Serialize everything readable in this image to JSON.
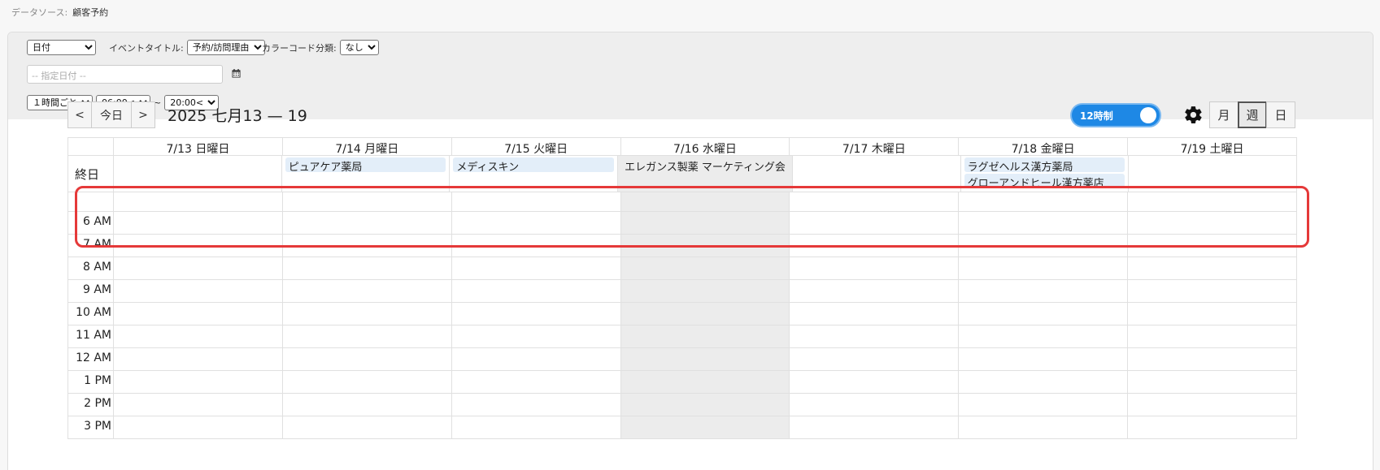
{
  "datasource": {
    "label": "データソース:",
    "value": "顧客予約"
  },
  "controls": {
    "date_field": "日付",
    "event_title_label": "イベントタイトル:",
    "event_title_value": "予約/訪問理由",
    "color_code_label": "カラーコード分類:",
    "color_code_value": "なし",
    "date_placeholder": "-- 指定日付 --",
    "interval": "１時間ごと",
    "start_time": "06:00<",
    "tilde": "~",
    "end_time": "20:00<"
  },
  "nav": {
    "prev": "<",
    "today": "今日",
    "next": ">"
  },
  "range_title": "2025 七月13 — 19",
  "toggle_label": "12時制",
  "views": {
    "month": "月",
    "week": "週",
    "day": "日"
  },
  "calendar": {
    "days": [
      "7/13 日曜日",
      "7/14 月曜日",
      "7/15 火曜日",
      "7/16 水曜日",
      "7/17 木曜日",
      "7/18 金曜日",
      "7/19 土曜日"
    ],
    "allday_label": "終日",
    "allday_events": {
      "d1": "ピュアケア薬局",
      "d2": "メディスキン",
      "d3": "エレガンス製薬 マーケティング会",
      "d5a": "ラグゼヘルス漢方薬局",
      "d5b": "グローアンドヒール漢方薬店"
    },
    "hours": [
      "6 AM",
      "7 AM",
      "8 AM",
      "9 AM",
      "10 AM",
      "11 AM",
      "12 AM",
      "1 PM",
      "2 PM",
      "3 PM"
    ]
  },
  "colors": {
    "toggle": "#1e88e5",
    "highlight": "#e53939",
    "event_bg": "#e3eef9",
    "today_bg": "#ececec"
  }
}
